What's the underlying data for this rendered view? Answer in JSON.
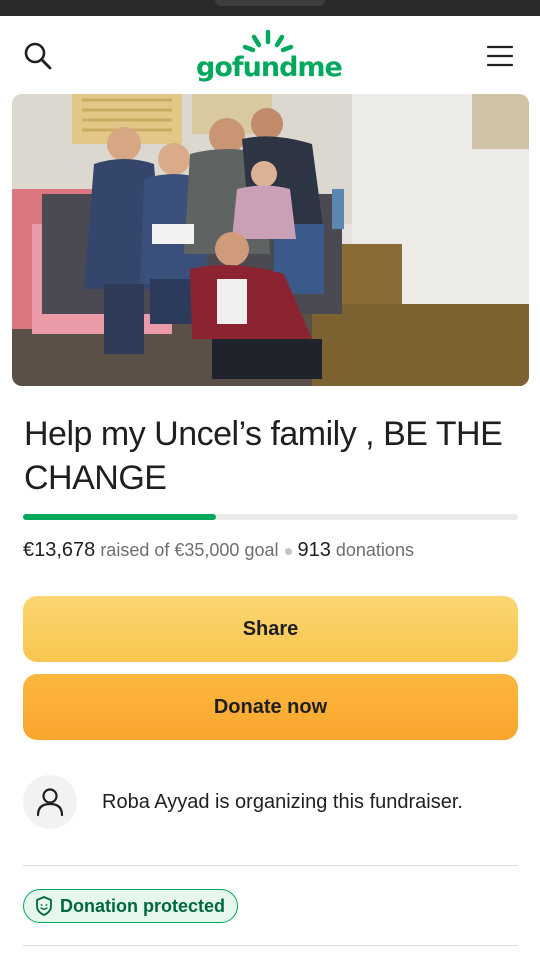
{
  "brand": {
    "logo_text": "gofundme",
    "primary_color": "#02a95c",
    "share_color": "#f8c64f",
    "donate_color": "#f9a62e"
  },
  "header": {
    "search_icon": "search-icon",
    "menu_icon": "hamburger-menu-icon"
  },
  "campaign": {
    "hero_image": "photo of a family of six posing on a couch indoors",
    "title": "Help my Uncel’s family , BE THE CHANGE",
    "raised": "€13,678",
    "raised_suffix": "raised of",
    "goal": "€35,000",
    "goal_suffix": "goal",
    "donations_count": "913",
    "donations_label": "donations",
    "progress_fraction": 0.39
  },
  "actions": {
    "share_label": "Share",
    "donate_label": "Donate now"
  },
  "organizer": {
    "text": "Roba Ayyad is organizing this fundraiser.",
    "avatar_icon": "user-icon"
  },
  "badge": {
    "label": "Donation protected",
    "icon": "shield-icon"
  }
}
